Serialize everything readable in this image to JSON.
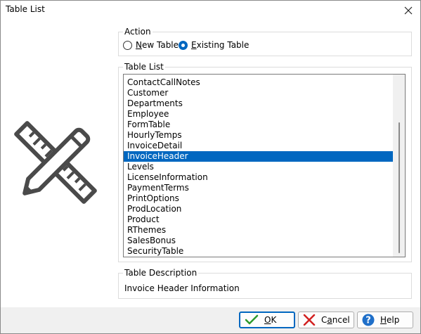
{
  "window": {
    "title": "Table List"
  },
  "action": {
    "legend": "Action",
    "options": [
      {
        "label": "New Table",
        "mnemonic": "N",
        "rest": "ew Table",
        "checked": false
      },
      {
        "label": "Existing Table",
        "mnemonic": "E",
        "rest": "xisting Table",
        "checked": true
      }
    ]
  },
  "table_list": {
    "legend": "Table List",
    "items": [
      "ContactCallNotes",
      "Customer",
      "Departments",
      "Employee",
      "FormTable",
      "HourlyTemps",
      "InvoiceDetail",
      "InvoiceHeader",
      "Levels",
      "LicenseInformation",
      "PaymentTerms",
      "PrintOptions",
      "ProdLocation",
      "Product",
      "RThemes",
      "SalesBonus",
      "SecurityTable"
    ],
    "selected": "InvoiceHeader"
  },
  "description": {
    "legend": "Table Description",
    "text": "Invoice Header Information"
  },
  "buttons": {
    "ok": {
      "mnemonic": "O",
      "rest": "K"
    },
    "cancel": {
      "label": "Cancel",
      "pre": "C",
      "mnemonic": "a",
      "rest": "ncel"
    },
    "help": {
      "mnemonic": "H",
      "rest": "elp"
    }
  },
  "icons": {
    "graphic": "ruler-pencil-icon",
    "close": "close-icon",
    "ok": "checkmark-icon",
    "cancel": "cancel-x-icon",
    "help": "help-icon"
  },
  "colors": {
    "accent": "#0067c0",
    "ok_check": "#2e9b2e",
    "cancel_x": "#d22020",
    "graphic": "#4a4a4a"
  }
}
